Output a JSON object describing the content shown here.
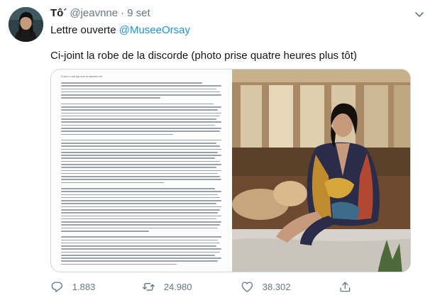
{
  "tweet": {
    "author": {
      "name": "Tô´",
      "handle": "@jeavnne"
    },
    "dot": "·",
    "date": "9 set",
    "text_line1_prefix": "Lettre ouverte ",
    "mention": "@MuseeOrsay",
    "text_line2": "Ci-joint la robe de la discorde (photo prise quatre heures plus tôt)",
    "media": {
      "document_title": "Certes ce sein que nous ne saurions voir"
    },
    "actions": {
      "reply_count": "1.883",
      "retweet_count": "24.980",
      "like_count": "38.302"
    },
    "colors": {
      "link": "#1b95e0",
      "secondary_text": "#657786",
      "border": "#ccd6dd"
    }
  }
}
